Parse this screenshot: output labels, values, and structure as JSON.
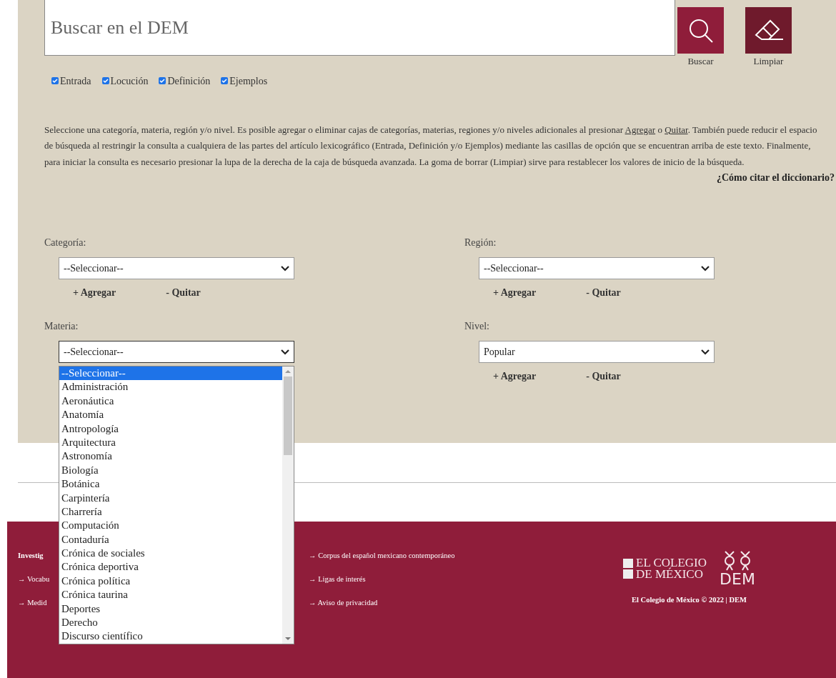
{
  "search": {
    "placeholder": "Buscar en el DEM"
  },
  "actions": [
    {
      "label": "Buscar",
      "kind": "search"
    },
    {
      "label": "Limpiar",
      "kind": "clear"
    }
  ],
  "filters": [
    {
      "label": "Entrada",
      "checked": true
    },
    {
      "label": "Locución",
      "checked": true
    },
    {
      "label": "Definición",
      "checked": true
    },
    {
      "label": "Ejemplos",
      "checked": true
    }
  ],
  "instructions": [
    {
      "text": "Seleccione una categoría, materia, región y/o nivel. Es posible agregar o eliminar cajas de categorías, materias, regiones y/o niveles adicionales al presionar ",
      "link": false
    },
    {
      "text": "Agregar",
      "link": true
    },
    {
      "text": " o ",
      "link": false
    },
    {
      "text": "Quitar",
      "link": true
    },
    {
      "text": ". También puede reducir el espacio de búsqueda al restringir la consulta a cualquiera de las partes del artículo lexicográfico (Entrada, Definición y/o Ejemplos) mediante las casillas de opción que se encuentran arriba de este texto. Finalmente, para iniciar la consulta es necesario presionar la lupa de la derecha de la caja de búsqueda avanzada. La goma de borrar (Limpiar) sirve para restablecer los valores de inicio de la búsqueda.",
      "link": false
    }
  ],
  "cite_link": "¿Cómo citar el diccionario?",
  "fields": [
    {
      "label": "Categoría:",
      "value": "--Seleccionar--",
      "add": "+ Agregar",
      "remove": "- Quitar",
      "expanded": false
    },
    {
      "label": "Región:",
      "value": "--Seleccionar--",
      "add": "+ Agregar",
      "remove": "- Quitar",
      "expanded": false
    },
    {
      "label": "Materia:",
      "value": "--Seleccionar--",
      "expanded": true,
      "options": [
        {
          "label": "--Seleccionar--",
          "selected": true
        },
        {
          "label": "Administración",
          "selected": false
        },
        {
          "label": "Aeronáutica",
          "selected": false
        },
        {
          "label": "Anatomía",
          "selected": false
        },
        {
          "label": "Antropología",
          "selected": false
        },
        {
          "label": "Arquitectura",
          "selected": false
        },
        {
          "label": "Astronomía",
          "selected": false
        },
        {
          "label": "Biología",
          "selected": false
        },
        {
          "label": "Botánica",
          "selected": false
        },
        {
          "label": "Carpintería",
          "selected": false
        },
        {
          "label": "Charrería",
          "selected": false
        },
        {
          "label": "Computación",
          "selected": false
        },
        {
          "label": "Contaduría",
          "selected": false
        },
        {
          "label": "Crónica de sociales",
          "selected": false
        },
        {
          "label": "Crónica deportiva",
          "selected": false
        },
        {
          "label": "Crónica política",
          "selected": false
        },
        {
          "label": "Crónica taurina",
          "selected": false
        },
        {
          "label": "Deportes",
          "selected": false
        },
        {
          "label": "Derecho",
          "selected": false
        },
        {
          "label": "Discurso científico",
          "selected": false
        }
      ]
    },
    {
      "label": "Nivel:",
      "value": "Popular",
      "add": "+ Agregar",
      "remove": "- Quitar",
      "expanded": false
    }
  ],
  "footer": {
    "column_1": [
      "Investig",
      "→ Vocabu",
      "→ Medid"
    ],
    "links": [
      "→ Corpus del español mexicano contemporáneo",
      "→ Ligas de interés",
      "→ Aviso de privacidad"
    ],
    "logo_lines": [
      "EL COLEGIO",
      "DE MÉXICO"
    ],
    "brand": "DEM",
    "copyright": "El Colegio de México © 2022 | DEM"
  }
}
